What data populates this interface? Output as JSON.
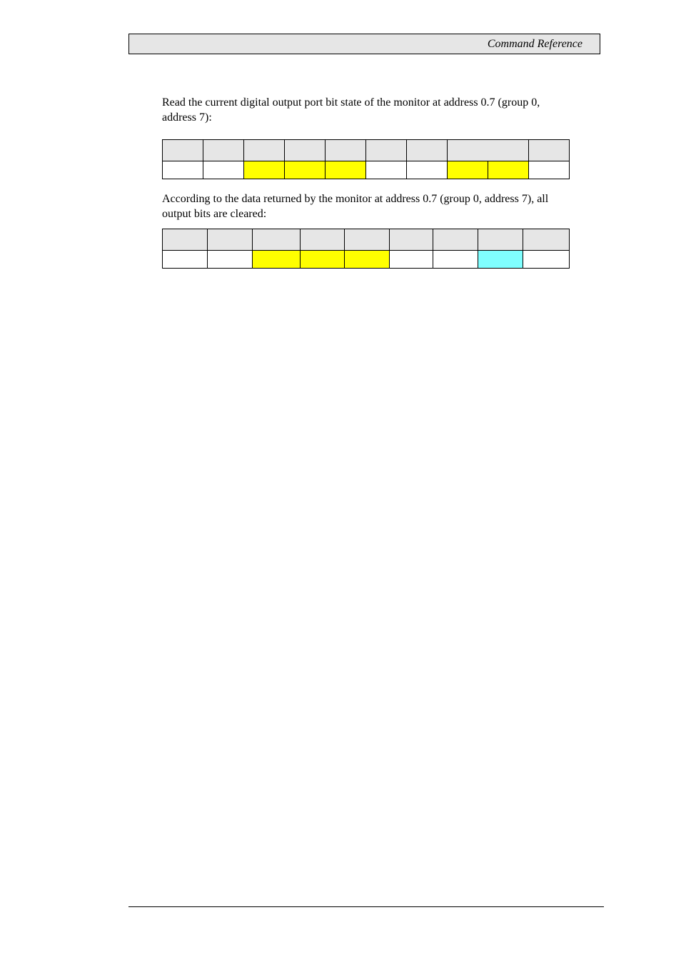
{
  "header": {
    "title": "Command Reference"
  },
  "paragraphs": {
    "intro": "Read the current digital output port bit state of the monitor at address 0.7 (group 0, address 7):",
    "result": "According to the data returned by the monitor at address 0.7 (group 0, address 7), all output bits are cleared:"
  },
  "colors": {
    "header_fill": "#e6e6e6",
    "highlight_yellow": "#ffff00",
    "highlight_cyan": "#80ffff"
  },
  "tables": [
    {
      "name": "command-frame",
      "header_cells": [
        "",
        "",
        "",
        "",
        "",
        "",
        "",
        "",
        ""
      ],
      "header_spans": [
        1,
        1,
        1,
        1,
        1,
        1,
        1,
        2,
        1
      ],
      "body_cells": [
        {
          "text": "",
          "highlight": "none"
        },
        {
          "text": "",
          "highlight": "none"
        },
        {
          "text": "",
          "highlight": "yellow"
        },
        {
          "text": "",
          "highlight": "yellow"
        },
        {
          "text": "",
          "highlight": "yellow"
        },
        {
          "text": "",
          "highlight": "none"
        },
        {
          "text": "",
          "highlight": "none"
        },
        {
          "text": "",
          "highlight": "yellow"
        },
        {
          "text": "",
          "highlight": "yellow"
        },
        {
          "text": "",
          "highlight": "none"
        }
      ]
    },
    {
      "name": "response-frame",
      "header_cells": [
        "",
        "",
        "",
        "",
        "",
        "",
        "",
        "",
        ""
      ],
      "body_cells": [
        {
          "text": "",
          "highlight": "none"
        },
        {
          "text": "",
          "highlight": "none"
        },
        {
          "text": "",
          "highlight": "yellow"
        },
        {
          "text": "",
          "highlight": "yellow"
        },
        {
          "text": "",
          "highlight": "yellow"
        },
        {
          "text": "",
          "highlight": "none"
        },
        {
          "text": "",
          "highlight": "none"
        },
        {
          "text": "",
          "highlight": "cyan"
        },
        {
          "text": "",
          "highlight": "none"
        }
      ]
    }
  ]
}
